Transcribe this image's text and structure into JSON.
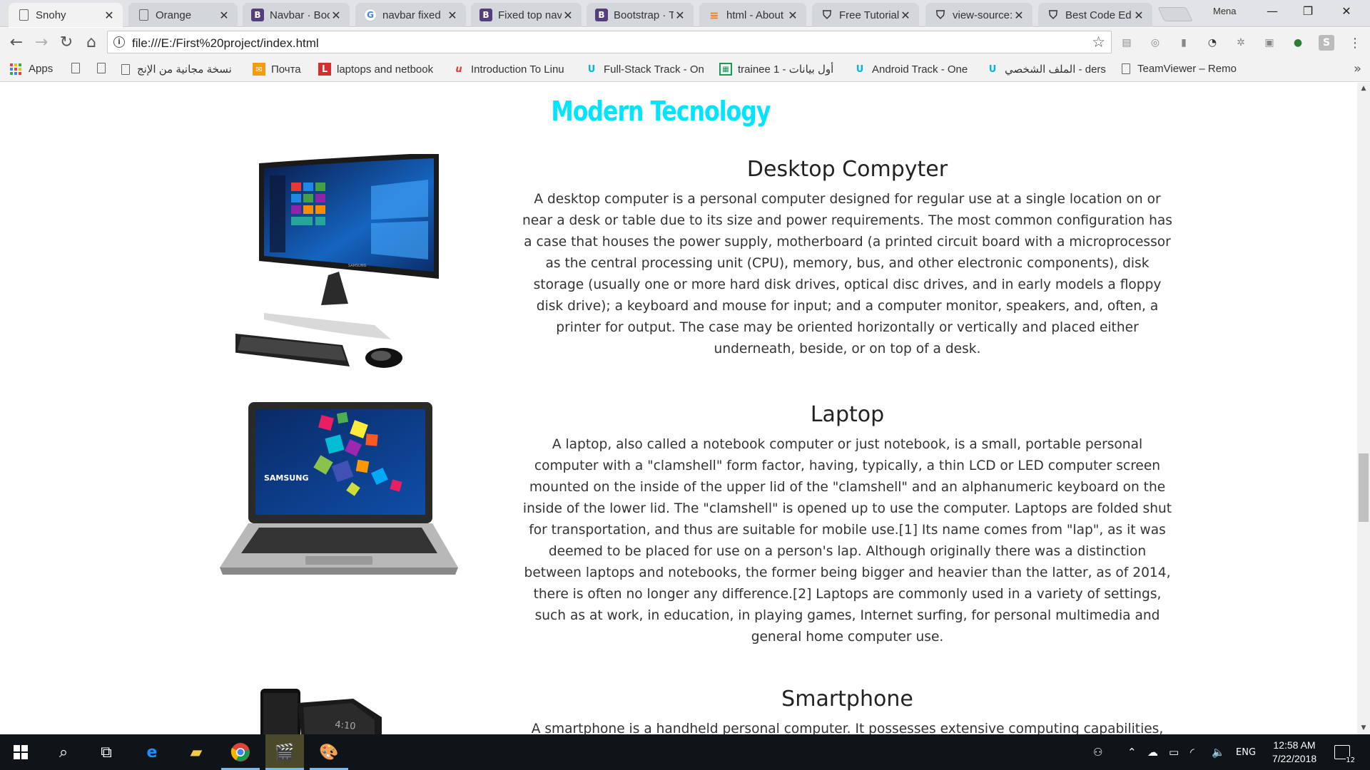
{
  "browser": {
    "tabs": [
      {
        "title": "Snohy",
        "icon": "page-icon",
        "active": true
      },
      {
        "title": "Orange",
        "icon": "page-icon"
      },
      {
        "title": "Navbar · Boo",
        "icon": "bootstrap-icon"
      },
      {
        "title": "navbar fixed",
        "icon": "google-icon"
      },
      {
        "title": "Fixed top nav",
        "icon": "bootstrap-icon"
      },
      {
        "title": "Bootstrap · T",
        "icon": "bootstrap-icon"
      },
      {
        "title": "html - About",
        "icon": "stackoverflow-icon"
      },
      {
        "title": "Free Tutorial",
        "icon": "shield-icon"
      },
      {
        "title": "view-source:",
        "icon": "shield-icon"
      },
      {
        "title": "Best Code Ed",
        "icon": "shield-icon"
      }
    ],
    "profile_name": "Mena",
    "url": "file:///E:/First%20project/index.html",
    "bookmarks": [
      {
        "label": "Apps",
        "icon": "apps-icon"
      },
      {
        "label": "",
        "icon": "page-icon"
      },
      {
        "label": "",
        "icon": "page-icon"
      },
      {
        "label": "نسخة مجانية من الإنج",
        "icon": "page-icon"
      },
      {
        "label": "Почта",
        "icon": "mail-icon"
      },
      {
        "label": "laptops and netbook",
        "icon": "l-icon"
      },
      {
        "label": "Introduction To Linu",
        "icon": "udacity-icon"
      },
      {
        "label": "Full-Stack Track - On",
        "icon": "udacity-icon"
      },
      {
        "label": "trainee 1 - أول بيانات",
        "icon": "sheets-icon"
      },
      {
        "label": "Android Track - One",
        "icon": "udacity-icon"
      },
      {
        "label": "الملف الشخصي - ders",
        "icon": "udacity-icon"
      },
      {
        "label": "TeamViewer – Remo",
        "icon": "page-icon"
      }
    ]
  },
  "page": {
    "site_title": "Modern Tecnology",
    "sections": [
      {
        "heading": "Desktop Compyter",
        "text": "A desktop computer is a personal computer designed for regular use at a single location on or near a desk or table due to its size and power requirements. The most common configuration has a case that houses the power supply, motherboard (a printed circuit board with a microprocessor as the central processing unit (CPU), memory, bus, and other electronic components), disk storage (usually one or more hard disk drives, optical disc drives, and in early models a floppy disk drive); a keyboard and mouse for input; and a computer monitor, speakers, and, often, a printer for output. The case may be oriented horizontally or vertically and placed either underneath, beside, or on top of a desk."
      },
      {
        "heading": "Laptop",
        "text": "A laptop, also called a notebook computer or just notebook, is a small, portable personal computer with a \"clamshell\" form factor, having, typically, a thin LCD or LED computer screen mounted on the inside of the upper lid of the \"clamshell\" and an alphanumeric keyboard on the inside of the lower lid. The \"clamshell\" is opened up to use the computer. Laptops are folded shut for transportation, and thus are suitable for mobile use.[1] Its name comes from \"lap\", as it was deemed to be placed for use on a person's lap. Although originally there was a distinction between laptops and notebooks, the former being bigger and heavier than the latter, as of 2014, there is often no longer any difference.[2] Laptops are commonly used in a variety of settings, such as at work, in education, in playing games, Internet surfing, for personal multimedia and general home computer use."
      },
      {
        "heading": "Smartphone",
        "text": "A smartphone is a handheld personal computer. It possesses extensive computing capabilities,"
      }
    ],
    "brand_laptop": "SAMSUNG",
    "phone_clock": "4:10"
  },
  "taskbar": {
    "language": "ENG",
    "time": "12:58 AM",
    "date": "7/22/2018",
    "notification_count": "12"
  },
  "colors": {
    "title_cyan": "#00e5ff",
    "taskbar_bg": "#0f1419"
  }
}
